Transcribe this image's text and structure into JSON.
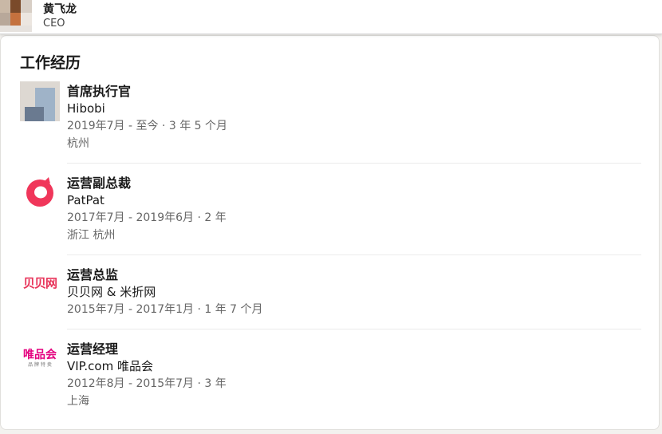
{
  "header": {
    "name": "黄飞龙",
    "title": "CEO"
  },
  "experience": {
    "heading": "工作经历",
    "items": [
      {
        "role": "首席执行官",
        "company": "Hibobi",
        "dates": "2019年7月 - 至今 · 3 年 5 个月",
        "location": "杭州",
        "logo": "hibobi-logo"
      },
      {
        "role": "运营副总裁",
        "company": "PatPat",
        "dates": "2017年7月 - 2019年6月 · 2 年",
        "location": "浙江 杭州",
        "logo": "patpat-logo",
        "logo_color": "#f0365a"
      },
      {
        "role": "运营总监",
        "company": "贝贝网 & 米折网",
        "dates": "2015年7月 - 2017年1月 · 1 年 7 个月",
        "location": "",
        "logo": "beibei-logo",
        "logo_text": "贝贝网",
        "logo_color": "#e8345a"
      },
      {
        "role": "运营经理",
        "company": "VIP.com 唯品会",
        "dates": "2012年8月 - 2015年7月 · 3 年",
        "location": "上海",
        "logo": "vip-logo",
        "logo_text": "唯品会",
        "logo_subtext": "品 牌 特 卖",
        "logo_color": "#e4007f"
      }
    ]
  }
}
